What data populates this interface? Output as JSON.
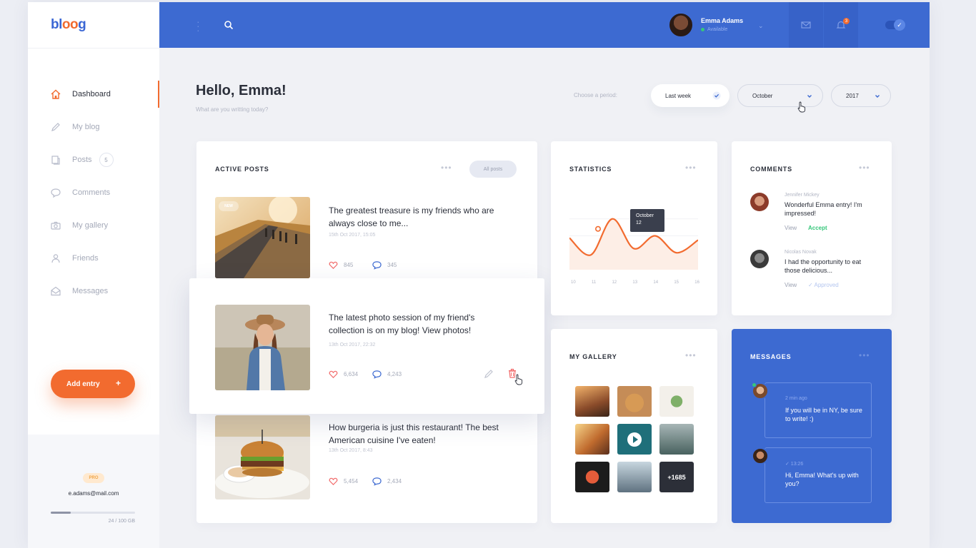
{
  "app": {
    "logo_a": "bl",
    "logo_b": "oo",
    "logo_c": "g"
  },
  "sidebar": {
    "items": [
      {
        "label": "Dashboard",
        "icon": "home-icon"
      },
      {
        "label": "My blog",
        "icon": "pen-icon"
      },
      {
        "label": "Posts",
        "icon": "posts-icon",
        "badge": "5"
      },
      {
        "label": "Comments",
        "icon": "comment-icon"
      },
      {
        "label": "My gallery",
        "icon": "camera-icon"
      },
      {
        "label": "Friends",
        "icon": "user-icon"
      },
      {
        "label": "Messages",
        "icon": "messages-icon"
      }
    ],
    "add_entry": "Add entry",
    "add_plus": "+",
    "pro": "PRO",
    "email": "e.adams@mail.com",
    "storage": "24 / 100 GB",
    "storage_fraction": 0.24
  },
  "header": {
    "user_name": "Emma Adams",
    "user_status": "Available",
    "notification_count": "3"
  },
  "greeting": {
    "title": "Hello, Emma!",
    "subtitle": "What are you writting today?"
  },
  "period": {
    "label": "Choose a period:",
    "week": "Last week",
    "month": "October",
    "year": "2017"
  },
  "active_posts": {
    "title": "ACTIVE POSTS",
    "all_posts": "All posts",
    "new_badge": "NEW",
    "posts": [
      {
        "title": "The greatest treasure is my friends who are always close to me...",
        "date": "15th Oct 2017, 15:05",
        "likes": "845",
        "comments": "345"
      },
      {
        "title": "The latest photo session of my friend's collection is on my blog! View photos!",
        "date": "13th Oct 2017, 22:32",
        "likes": "6,634",
        "comments": "4,243"
      },
      {
        "title": "How burgeria is just this restaurant! The best American cuisine I've eaten!",
        "date": "13th Oct 2017, 8:43",
        "likes": "5,454",
        "comments": "2,434"
      }
    ]
  },
  "statistics": {
    "title": "STATISTICS",
    "tooltip_month": "October",
    "tooltip_value": "12"
  },
  "chart_data": {
    "type": "line",
    "x": [
      10,
      11,
      12,
      13,
      14,
      15,
      16
    ],
    "values": [
      7.5,
      3.5,
      12,
      5,
      8,
      4,
      7
    ],
    "highlight": {
      "x": 12,
      "label": "October",
      "value": 12
    },
    "color": "#f26b2f",
    "ylim": [
      0,
      16
    ]
  },
  "comments": {
    "title": "COMMENTS",
    "items": [
      {
        "author": "Jennifer Mickey",
        "text": "Wonderful Emma entry! I'm impressed!",
        "view": "View",
        "action": "Accept"
      },
      {
        "author": "Nicolas Novak",
        "text": "I had the opportunity to eat those delicious...",
        "view": "View",
        "action": "✓ Approved"
      }
    ]
  },
  "gallery": {
    "title": "MY GALLERY",
    "more": "+1685"
  },
  "messages": {
    "title": "MESSAGES",
    "items": [
      {
        "time": "2 min ago",
        "text": "If you will be in NY, be sure to write! :)"
      },
      {
        "time": "✓ 13:26",
        "text": "Hi, Emma! What's up with you?"
      }
    ]
  },
  "colors": {
    "primary": "#3d6ad1",
    "accent": "#f26b2f",
    "success": "#37c77b"
  }
}
